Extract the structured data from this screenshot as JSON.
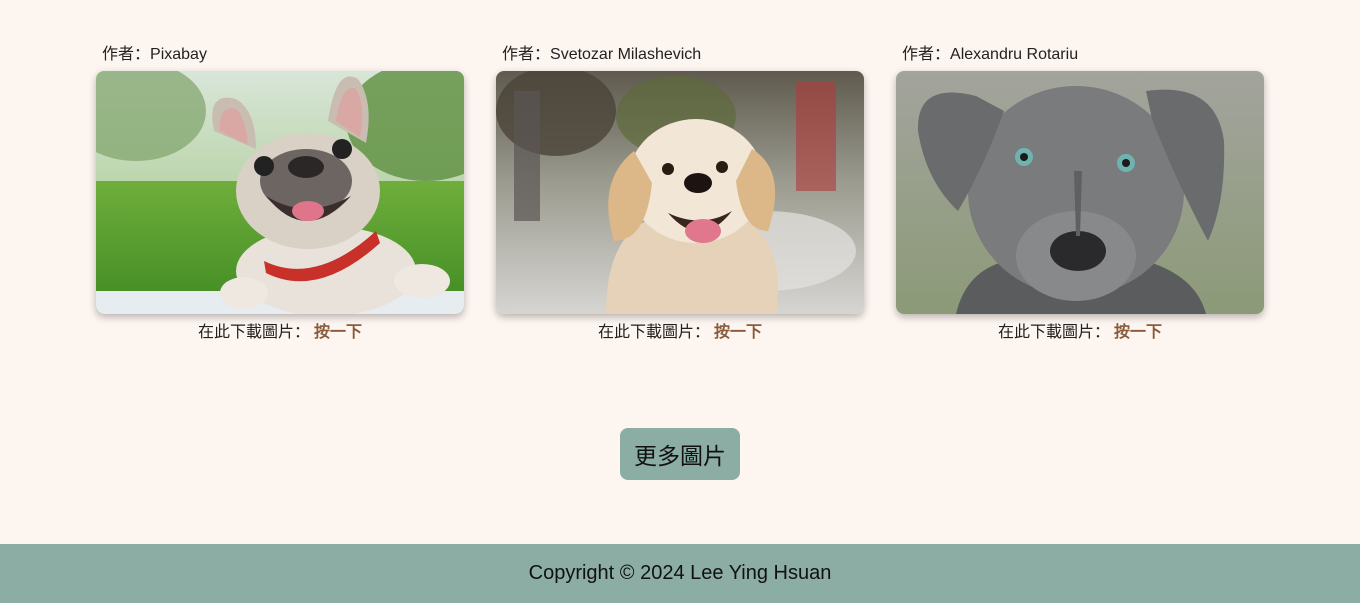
{
  "cards": [
    {
      "author_label": "作者：",
      "author": "Pixabay",
      "image_alt": "French bulldog photo",
      "download_label": "在此下載圖片：",
      "download_link": "按一下"
    },
    {
      "author_label": "作者：",
      "author": "Svetozar Milashevich",
      "image_alt": "Golden retriever photo",
      "download_label": "在此下載圖片：",
      "download_link": "按一下"
    },
    {
      "author_label": "作者：",
      "author": "Alexandru Rotariu",
      "image_alt": "Gray dog photo",
      "download_label": "在此下載圖片：",
      "download_link": "按一下"
    }
  ],
  "more_button": "更多圖片",
  "footer": {
    "copyright": "Copyright © 2024 Lee Ying Hsuan"
  },
  "colors": {
    "background": "#fdf5f0",
    "accent": "#8cada4",
    "link": "#8a5a3c"
  }
}
